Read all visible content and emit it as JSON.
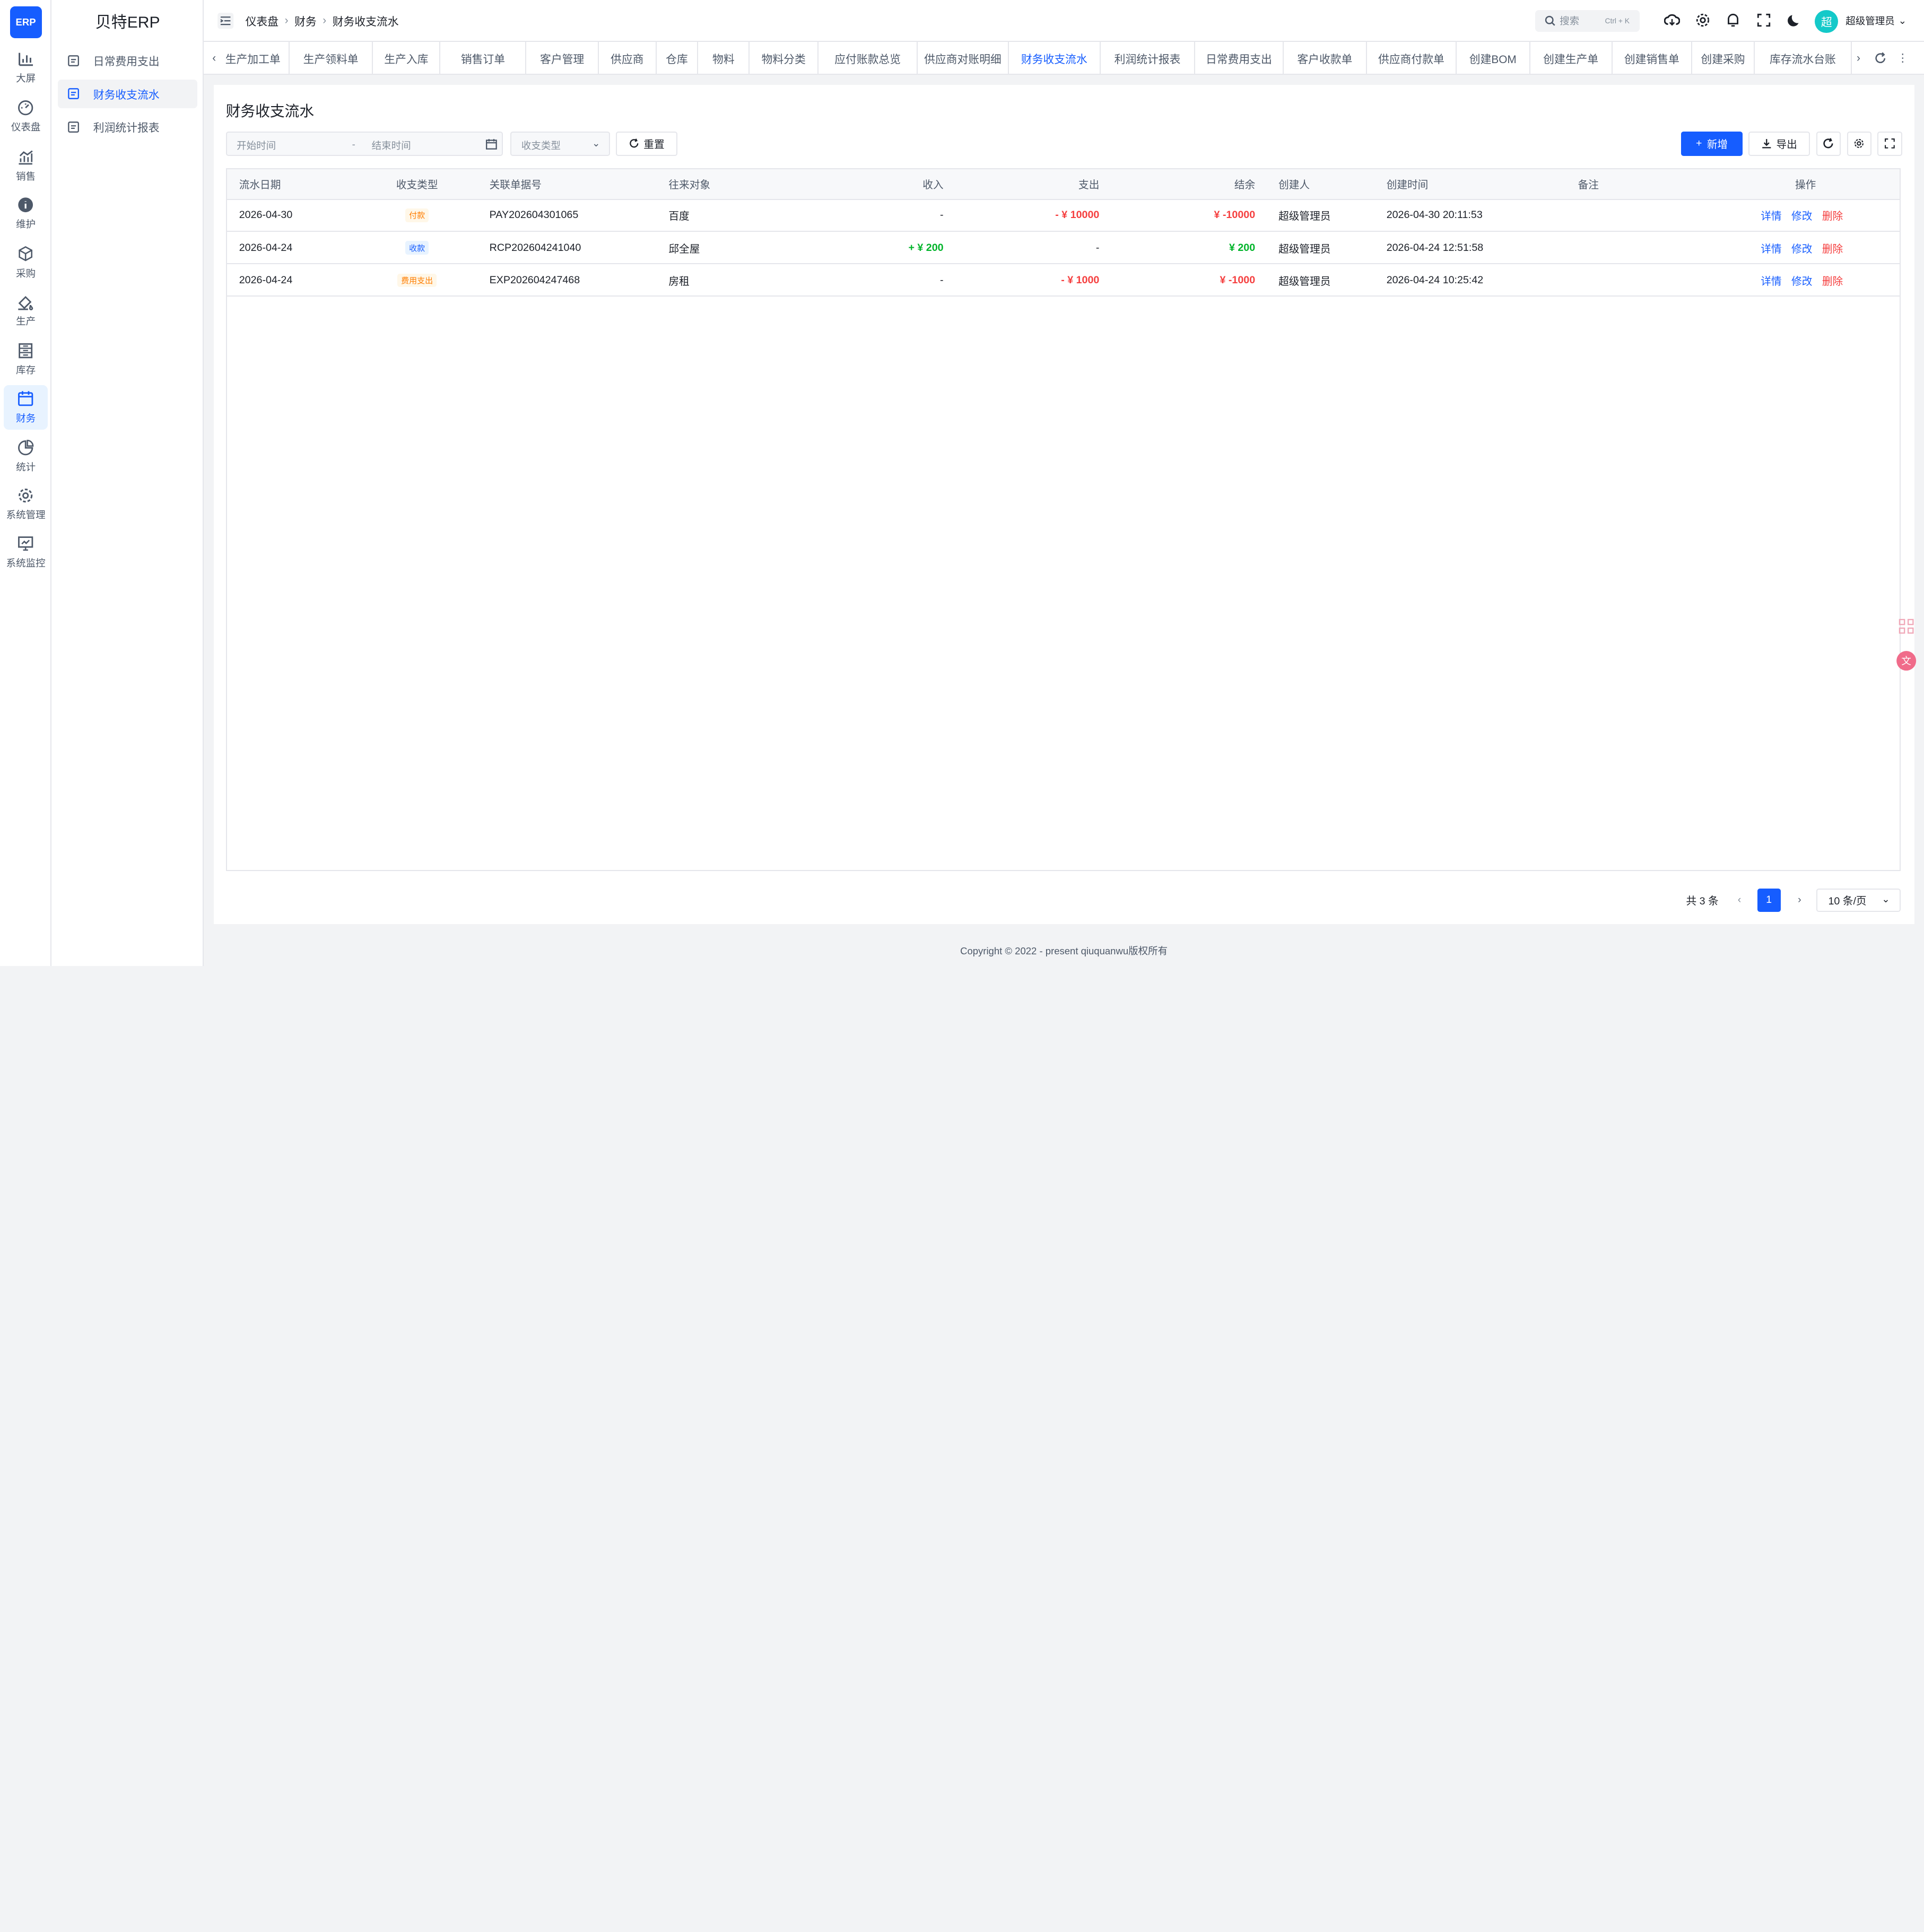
{
  "app": {
    "logo_text": "ERP",
    "brand": "贝特ERP"
  },
  "rail": [
    {
      "label": "大屏",
      "icon": "chart-bar-icon"
    },
    {
      "label": "仪表盘",
      "icon": "dashboard-icon"
    },
    {
      "label": "销售",
      "icon": "trend-chart-icon"
    },
    {
      "label": "维护",
      "icon": "info-icon"
    },
    {
      "label": "采购",
      "icon": "cube-icon"
    },
    {
      "label": "生产",
      "icon": "paint-bucket-icon"
    },
    {
      "label": "库存",
      "icon": "storage-icon"
    },
    {
      "label": "财务",
      "icon": "calendar-icon"
    },
    {
      "label": "统计",
      "icon": "pie-chart-icon"
    },
    {
      "label": "系统管理",
      "icon": "gear-icon"
    },
    {
      "label": "系统监控",
      "icon": "monitor-icon"
    }
  ],
  "submenu": [
    {
      "label": "日常费用支出",
      "icon": "document-icon"
    },
    {
      "label": "财务收支流水",
      "icon": "ledger-icon"
    },
    {
      "label": "利润统计报表",
      "icon": "report-icon"
    }
  ],
  "breadcrumb": [
    "仪表盘",
    "财务",
    "财务收支流水"
  ],
  "header": {
    "search_placeholder": "搜索",
    "search_shortcut": "Ctrl + K",
    "avatar_text": "超",
    "user_name": "超级管理员"
  },
  "tabs": [
    "生产加工单",
    "生产领料单",
    "生产入库",
    "销售订单",
    "客户管理",
    "供应商",
    "仓库",
    "物料",
    "物料分类",
    "应付账款总览",
    "供应商对账明细",
    "财务收支流水",
    "利润统计报表",
    "日常费用支出",
    "客户收款单",
    "供应商付款单",
    "创建BOM",
    "创建生产单",
    "创建销售单",
    "创建采购",
    "库存流水台账"
  ],
  "page": {
    "title": "财务收支流水",
    "start_placeholder": "开始时间",
    "range_separator": "-",
    "end_placeholder": "结束时间",
    "type_placeholder": "收支类型",
    "reset_label": "重置",
    "add_label": "新增",
    "export_label": "导出"
  },
  "table": {
    "columns": [
      "流水日期",
      "收支类型",
      "关联单据号",
      "往来对象",
      "收入",
      "支出",
      "结余",
      "创建人",
      "创建时间",
      "备注",
      "操作"
    ],
    "rows": [
      {
        "date": "2026-04-30",
        "type": "付款",
        "type_color": "#ff7d00",
        "type_bg": "#fff7e8",
        "doc": "PAY202604301065",
        "party": "百度",
        "income": "-",
        "expense": "- ¥ 10000",
        "balance": "¥ -10000",
        "balance_color": "#f53f3f",
        "creator": "超级管理员",
        "created": "2026-04-30 20:11:53",
        "note": ""
      },
      {
        "date": "2026-04-24",
        "type": "收款",
        "type_color": "#165dff",
        "type_bg": "#e8f3ff",
        "doc": "RCP202604241040",
        "party": "邱全屋",
        "income": "+ ¥ 200",
        "expense": "-",
        "balance": "¥ 200",
        "balance_color": "#00b42a",
        "creator": "超级管理员",
        "created": "2026-04-24 12:51:58",
        "note": ""
      },
      {
        "date": "2026-04-24",
        "type": "费用支出",
        "type_color": "#ff7d00",
        "type_bg": "#fff7e8",
        "doc": "EXP202604247468",
        "party": "房租",
        "income": "-",
        "expense": "- ¥ 1000",
        "balance": "¥ -1000",
        "balance_color": "#f53f3f",
        "creator": "超级管理员",
        "created": "2026-04-24 10:25:42",
        "note": ""
      }
    ],
    "actions": [
      "详情",
      "修改",
      "删除"
    ]
  },
  "pagination": {
    "total": "共 3 条",
    "current": "1",
    "page_size": "10 条/页"
  },
  "footer": "Copyright © 2022 - present qiuquanwu版权所有",
  "colors": {
    "primary": "#165dff",
    "success": "#00b42a",
    "danger": "#f53f3f"
  }
}
